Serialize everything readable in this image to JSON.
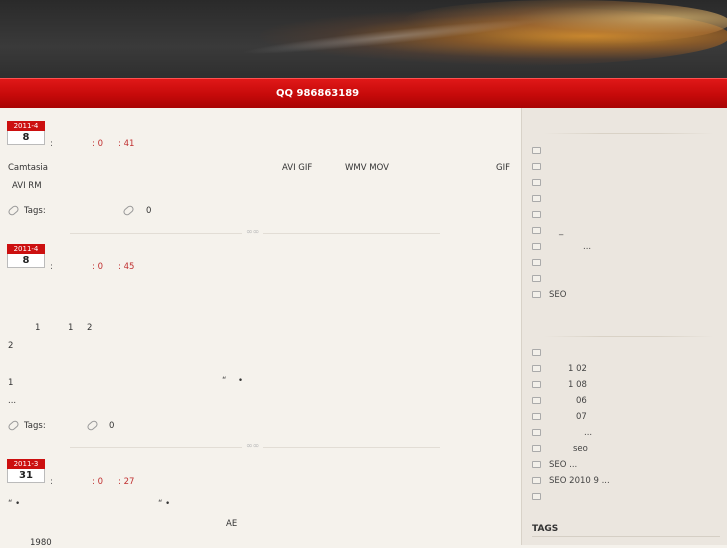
{
  "header": {
    "bar_text": "QQ 986863189"
  },
  "posts": [
    {
      "month": "2011-4",
      "day": "8",
      "meta_colon": ":",
      "meta_a": ": 0",
      "meta_b": ": 41",
      "lines": [
        "Camtasia",
        "AVI GIF",
        "WMV MOV",
        "GIF",
        "AVI RM"
      ],
      "tags_label": "Tags:",
      "comments": "0"
    },
    {
      "month": "2011-4",
      "day": "8",
      "meta_colon": ":",
      "meta_a": ": 0",
      "meta_b": ": 45",
      "lines": [
        "1",
        "1",
        "2",
        "2",
        "1",
        "“",
        "•",
        "..."
      ],
      "tags_label": "Tags:",
      "comments": "0"
    },
    {
      "month": "2011-3",
      "day": "31",
      "meta_colon": ":",
      "meta_a": ": 0",
      "meta_b": ": 27",
      "lines": [
        "“ •",
        "“ •",
        "AE",
        "1980"
      ]
    }
  ],
  "divider_ornament": "∞∞",
  "sidebar": {
    "categories": [
      "",
      "",
      "",
      "",
      "",
      "_",
      "...",
      "",
      "",
      "SEO"
    ],
    "archives": [
      "",
      "1 02",
      "1 08",
      "06",
      "07",
      "...",
      "seo",
      "SEO ...",
      "SEO 2010 9 ...",
      ""
    ],
    "tags_title": "TAGS"
  }
}
